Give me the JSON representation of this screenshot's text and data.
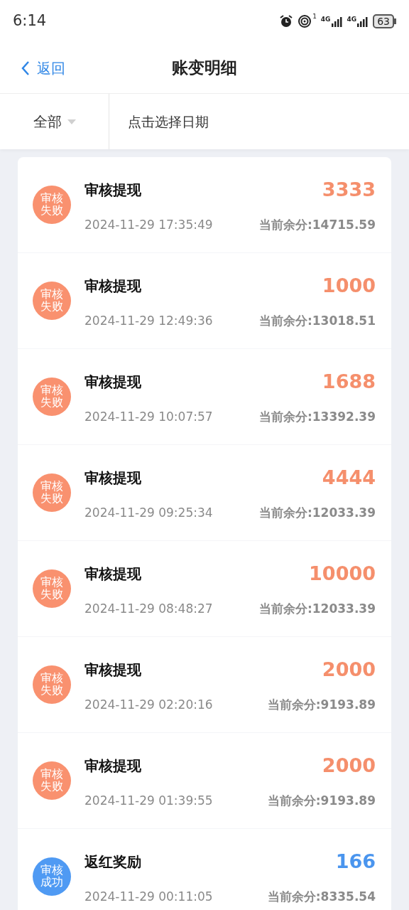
{
  "status_bar": {
    "time": "6:14",
    "sim_badge": "1",
    "network": [
      "4G",
      "4G"
    ],
    "battery": "63"
  },
  "header": {
    "back": "返回",
    "title": "账变明细"
  },
  "filter": {
    "type": "全部",
    "date_placeholder": "点击选择日期"
  },
  "records": [
    {
      "kind": "failed",
      "badge": "审核失败",
      "title": "审核提现",
      "amount": "3333",
      "time": "2024-11-29 17:35:49",
      "balance": "当前余分:14715.59"
    },
    {
      "kind": "failed",
      "badge": "审核失败",
      "title": "审核提现",
      "amount": "1000",
      "time": "2024-11-29 12:49:36",
      "balance": "当前余分:13018.51"
    },
    {
      "kind": "failed",
      "badge": "审核失败",
      "title": "审核提现",
      "amount": "1688",
      "time": "2024-11-29 10:07:57",
      "balance": "当前余分:13392.39"
    },
    {
      "kind": "failed",
      "badge": "审核失败",
      "title": "审核提现",
      "amount": "4444",
      "time": "2024-11-29 09:25:34",
      "balance": "当前余分:12033.39"
    },
    {
      "kind": "failed",
      "badge": "审核失败",
      "title": "审核提现",
      "amount": "10000",
      "time": "2024-11-29 08:48:27",
      "balance": "当前余分:12033.39"
    },
    {
      "kind": "failed",
      "badge": "审核失败",
      "title": "审核提现",
      "amount": "2000",
      "time": "2024-11-29 02:20:16",
      "balance": "当前余分:9193.89"
    },
    {
      "kind": "failed",
      "badge": "审核失败",
      "title": "审核提现",
      "amount": "2000",
      "time": "2024-11-29 01:39:55",
      "balance": "当前余分:9193.89"
    },
    {
      "kind": "success",
      "badge": "审核成功",
      "title": "返红奖励",
      "amount": "166",
      "time": "2024-11-29 00:11:05",
      "balance": "当前余分:8335.54"
    }
  ]
}
